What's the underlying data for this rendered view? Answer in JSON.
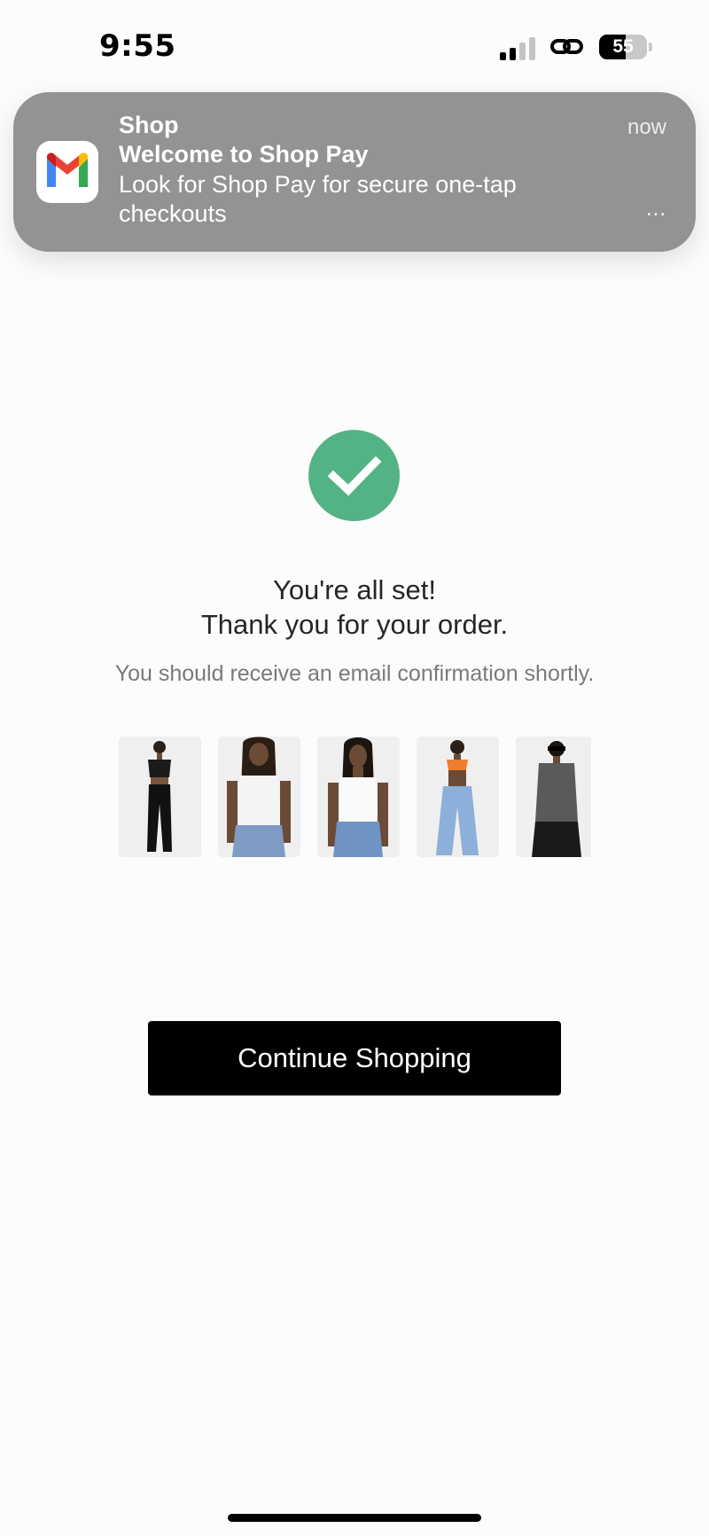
{
  "status_bar": {
    "time": "9:55",
    "battery_level": "55",
    "battery_fraction": 0.55
  },
  "notification": {
    "app_icon": "gmail-icon",
    "app_name": "Shop",
    "title": "Welcome to Shop Pay",
    "body": "Look for Shop Pay for secure one-tap checkouts",
    "time": "now",
    "more_label": "..."
  },
  "confirmation": {
    "icon": "checkmark-icon",
    "headline_line1": "You're all set!",
    "headline_line2": "Thank you for your order.",
    "subtext": "You should receive an email confirmation shortly.",
    "accent_color": "#54b385"
  },
  "products": [
    {
      "name": "product-thumb-1",
      "top_color": "#1b1b1b",
      "bottom_color": "#111111"
    },
    {
      "name": "product-thumb-2",
      "top_color": "#f4f4f4",
      "bottom_color": "#7e9cc3"
    },
    {
      "name": "product-thumb-3",
      "top_color": "#fafafa",
      "bottom_color": "#6f93c3"
    },
    {
      "name": "product-thumb-4",
      "top_color": "#f07d2d",
      "bottom_color": "#8db0da"
    },
    {
      "name": "product-thumb-5",
      "top_color": "#5a5a5a",
      "bottom_color": "#1a1a1a"
    }
  ],
  "cta": {
    "label": "Continue Shopping"
  }
}
